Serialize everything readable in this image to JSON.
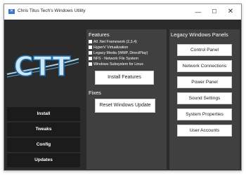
{
  "window": {
    "title": "Chris Titus Tech's Windows Utility",
    "app_icon": "utility-app-icon"
  },
  "titlebar_buttons": {
    "minimize": "—",
    "maximize": "☐",
    "close": "✕"
  },
  "logo": {
    "text": "CTT",
    "colors": {
      "letters": "#cfe6f5",
      "stroke": "#1d6fb3",
      "swoosh": "#9fd0ef"
    }
  },
  "nav": [
    "Install",
    "Tweaks",
    "Config",
    "Updates"
  ],
  "features": {
    "heading": "Features",
    "checkboxes": [
      {
        "label": "All .Net Framework (2,3,4)",
        "checked": false
      },
      {
        "label": "HyperV Virtualization",
        "checked": false
      },
      {
        "label": "Legacy Media (WMP, DirectPlay)",
        "checked": false
      },
      {
        "label": "NFS - Network File System",
        "checked": false
      },
      {
        "label": "Windows Subsystem for Linux",
        "checked": false
      }
    ],
    "install_button": "Install Features",
    "fixes_heading": "Fixes",
    "reset_button": "Reset Windows Update"
  },
  "legacy": {
    "heading": "Legacy Windows Panels",
    "buttons": [
      "Control Panel",
      "Network Connections",
      "Power Panel",
      "Sound Settings",
      "System Properties",
      "User Accounts"
    ]
  },
  "colors": {
    "background": "#2b2b2b",
    "panel": "#404040",
    "nav": "#1b1b1b",
    "button": "#ffffff"
  }
}
